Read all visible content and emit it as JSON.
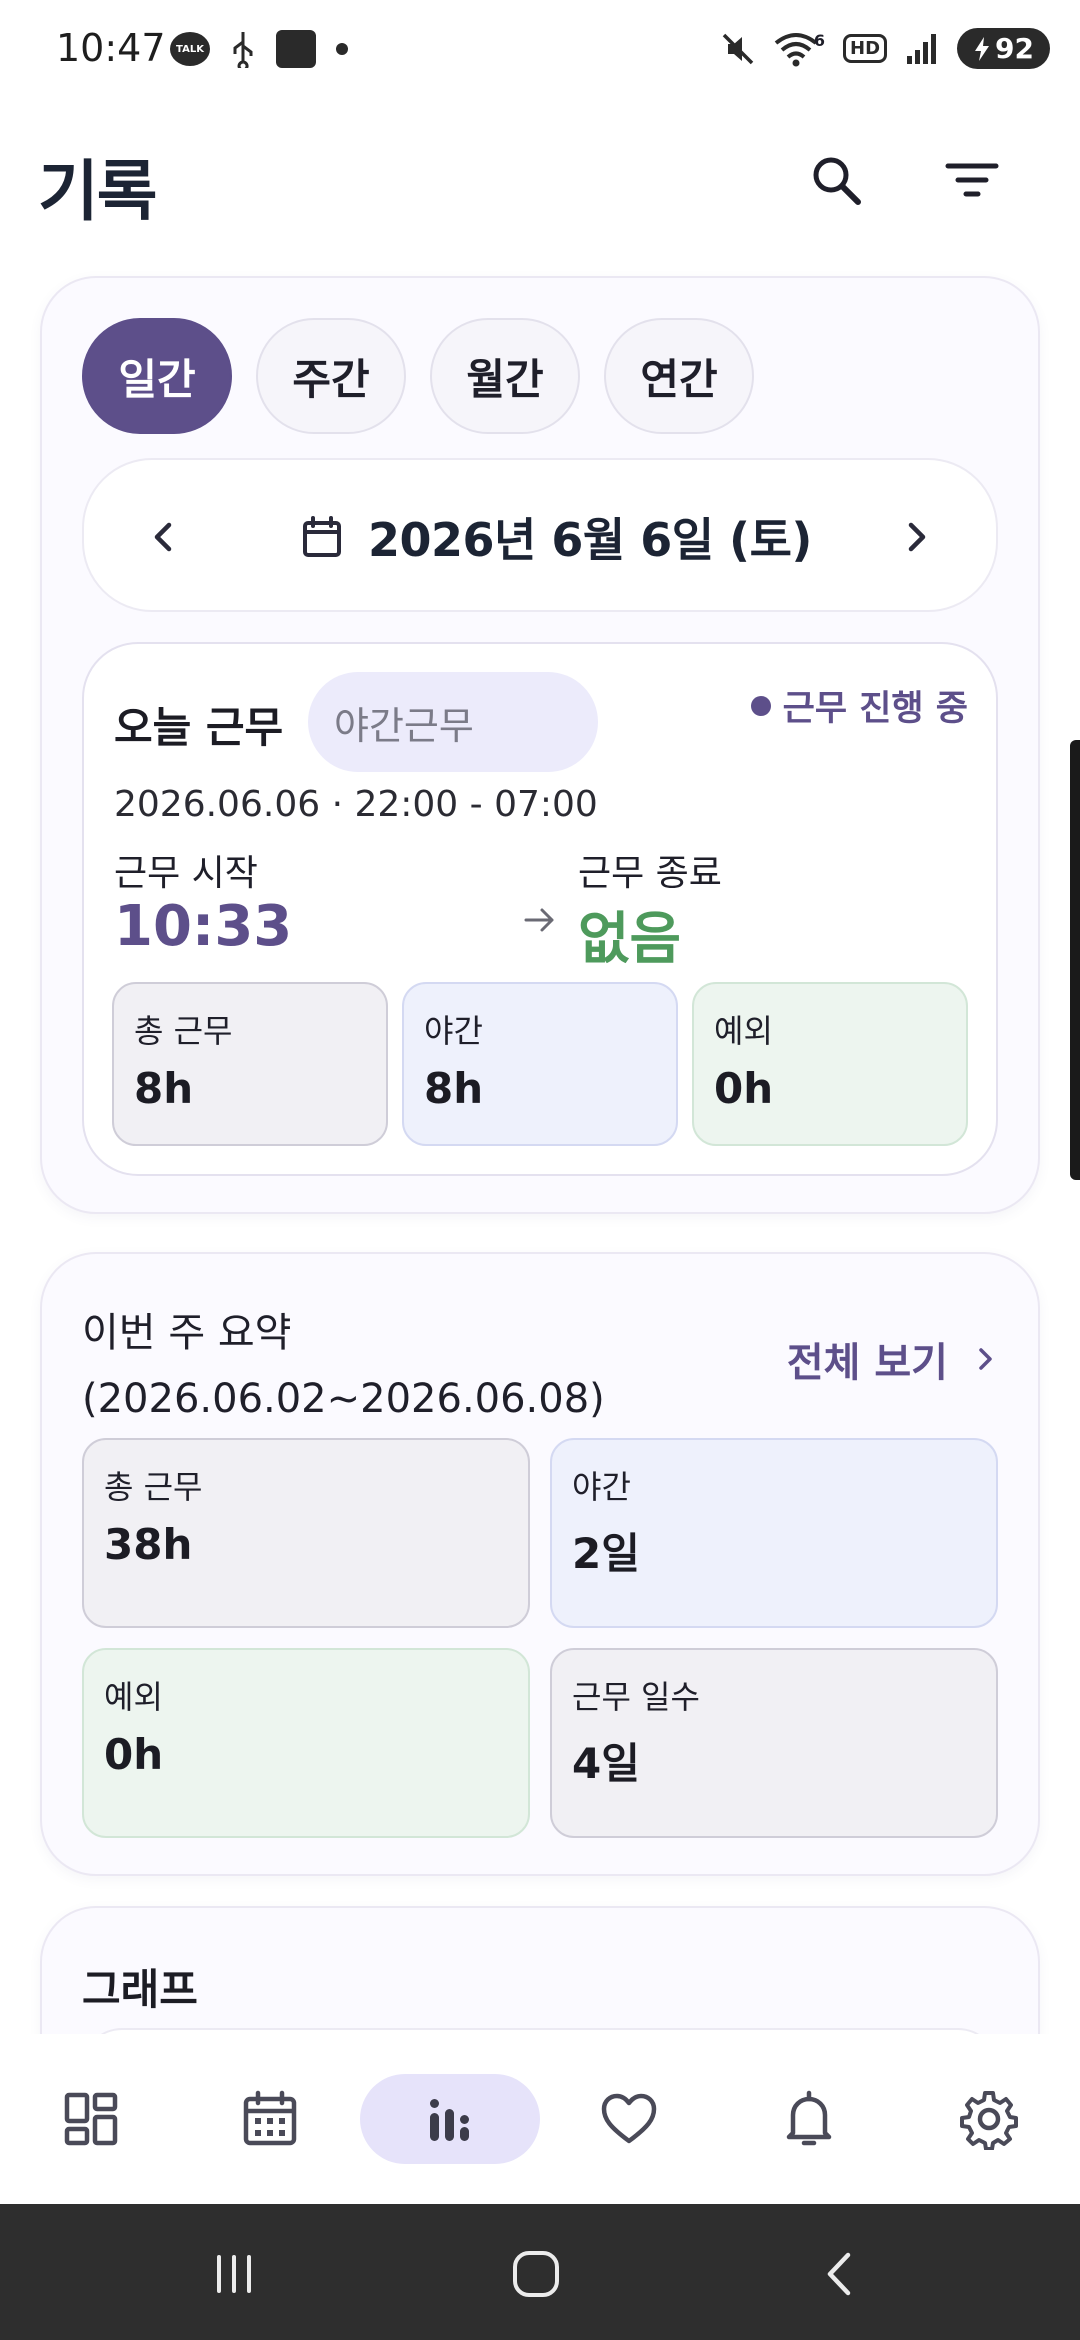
{
  "status_bar": {
    "time": "10:47",
    "talk_badge": "TALK",
    "hd_badge": "HD",
    "wifi_badge": "6",
    "battery": "92"
  },
  "header": {
    "title": "기록"
  },
  "period_tabs": [
    {
      "label": "일간",
      "active": true
    },
    {
      "label": "주간",
      "active": false
    },
    {
      "label": "월간",
      "active": false
    },
    {
      "label": "연간",
      "active": false
    }
  ],
  "date_nav": {
    "date": "2026년 6월 6일 (토)"
  },
  "today": {
    "title": "오늘 근무",
    "shift_type": "야간근무",
    "status": "근무 진행 중",
    "range": "2026.06.06 · 22:00 - 07:00",
    "start_label": "근무 시작",
    "start_time": "10:33",
    "end_label": "근무 종료",
    "end_time": "없음",
    "stats": [
      {
        "label": "총 근무",
        "value": "8h"
      },
      {
        "label": "야간",
        "value": "8h"
      },
      {
        "label": "예외",
        "value": "0h"
      }
    ]
  },
  "week": {
    "title_line1": "이번 주 요약",
    "title_line2": "(2026.06.02~2026.06.08)",
    "view_all": "전체 보기",
    "stats": [
      {
        "label": "총 근무",
        "value": "38h"
      },
      {
        "label": "야간",
        "value": "2일"
      },
      {
        "label": "예외",
        "value": "0h"
      },
      {
        "label": "근무 일수",
        "value": "4일"
      }
    ]
  },
  "graph": {
    "title": "그래프"
  },
  "colors": {
    "accent": "#5d4f8a",
    "end_green": "#4e9a5c",
    "nav_active": "#e6e3fa"
  },
  "bottom_nav": [
    {
      "icon": "dashboard-icon"
    },
    {
      "icon": "calendar-icon"
    },
    {
      "icon": "stats-icon",
      "active": true
    },
    {
      "icon": "heart-icon"
    },
    {
      "icon": "bell-icon"
    },
    {
      "icon": "gear-icon"
    }
  ]
}
